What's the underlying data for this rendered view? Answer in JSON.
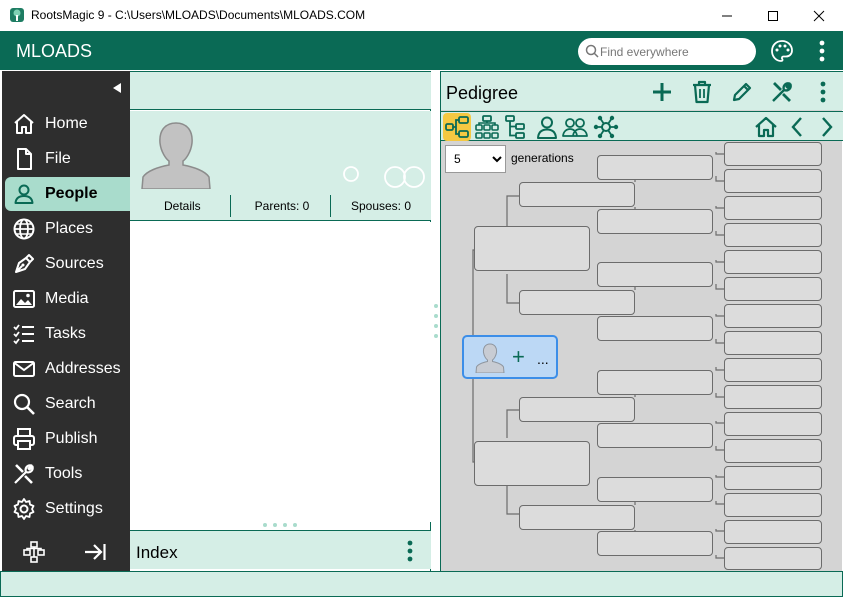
{
  "window": {
    "title": "RootsMagic 9 - C:\\Users\\MLOADS\\Documents\\MLOADS.COM",
    "minimize_icon": "minimize-icon",
    "maximize_icon": "maximize-icon",
    "close_icon": "close-icon"
  },
  "header": {
    "brand": "MLOADS",
    "search_placeholder": "Find everywhere",
    "search_value": ""
  },
  "sidebar": {
    "items": [
      {
        "label": "Home",
        "icon": "home-icon"
      },
      {
        "label": "File",
        "icon": "file-icon"
      },
      {
        "label": "People",
        "icon": "person-icon",
        "active": true
      },
      {
        "label": "Places",
        "icon": "globe-icon"
      },
      {
        "label": "Sources",
        "icon": "pen-nib-icon"
      },
      {
        "label": "Media",
        "icon": "image-icon"
      },
      {
        "label": "Tasks",
        "icon": "tasks-icon"
      },
      {
        "label": "Addresses",
        "icon": "envelope-icon"
      },
      {
        "label": "Search",
        "icon": "search-icon"
      },
      {
        "label": "Publish",
        "icon": "printer-icon"
      },
      {
        "label": "Tools",
        "icon": "tools-icon"
      },
      {
        "label": "Settings",
        "icon": "gear-icon"
      }
    ]
  },
  "person_card": {
    "tabs": {
      "details": "Details",
      "parents": "Parents: 0",
      "spouses": "Spouses: 0"
    }
  },
  "index": {
    "label": "Index"
  },
  "pedigree": {
    "title": "Pedigree",
    "generations_value": "5",
    "generations_options": [
      "5"
    ],
    "generations_label": "generations",
    "root_more": "..."
  },
  "colors": {
    "brand": "#0a6a55",
    "panel_light": "#d5eee6",
    "active_nav": "#a9dccc",
    "sidebar": "#2e2e2e",
    "active_tool": "#f5c842",
    "root_box": "#bcd8f5"
  }
}
